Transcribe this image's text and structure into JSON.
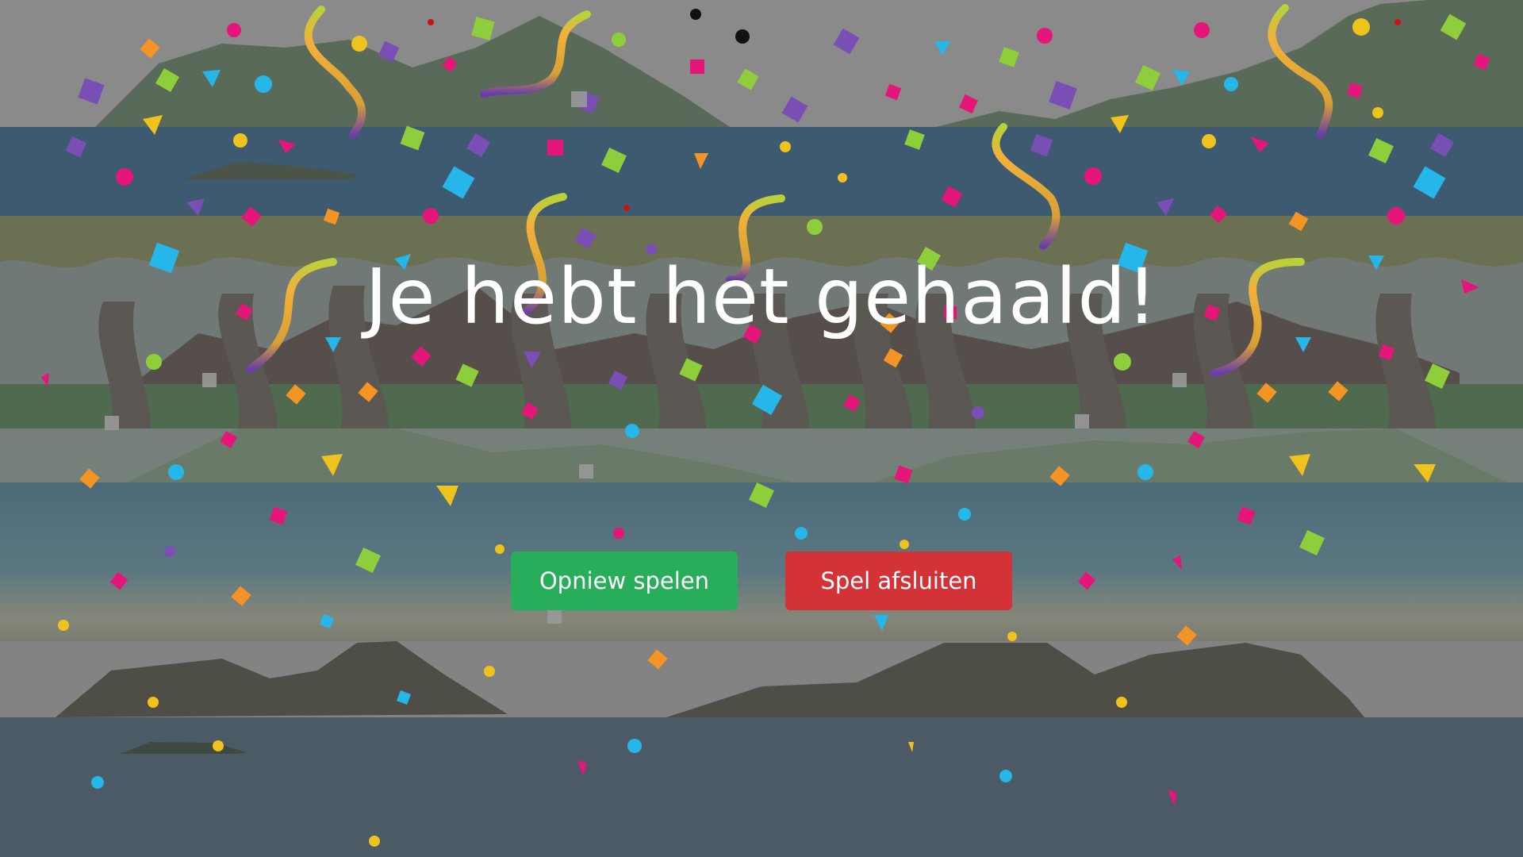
{
  "screen": {
    "title": "Je hebt het gehaald!"
  },
  "buttons": {
    "play_again": {
      "label": "Opniew spelen",
      "color": "#28ad5b"
    },
    "quit": {
      "label": "Spel afsluiten",
      "color": "#d33237"
    }
  },
  "colors": {
    "sky_gray": "#8a8a8a",
    "river_blue": "#3d5a70",
    "tree_band": "#6e7768",
    "meadow_green": "#4f6a4f",
    "mountain": "#5a6a58",
    "ground_dark": "#4c5a65",
    "confetti": [
      "#a54fd1",
      "#f0c21c",
      "#25b6ea",
      "#e5157a",
      "#f39425",
      "#8fce3b",
      "#999999"
    ]
  },
  "icons": {
    "confetti": "confetti-pieces",
    "streamer": "ribbon-streamer"
  }
}
